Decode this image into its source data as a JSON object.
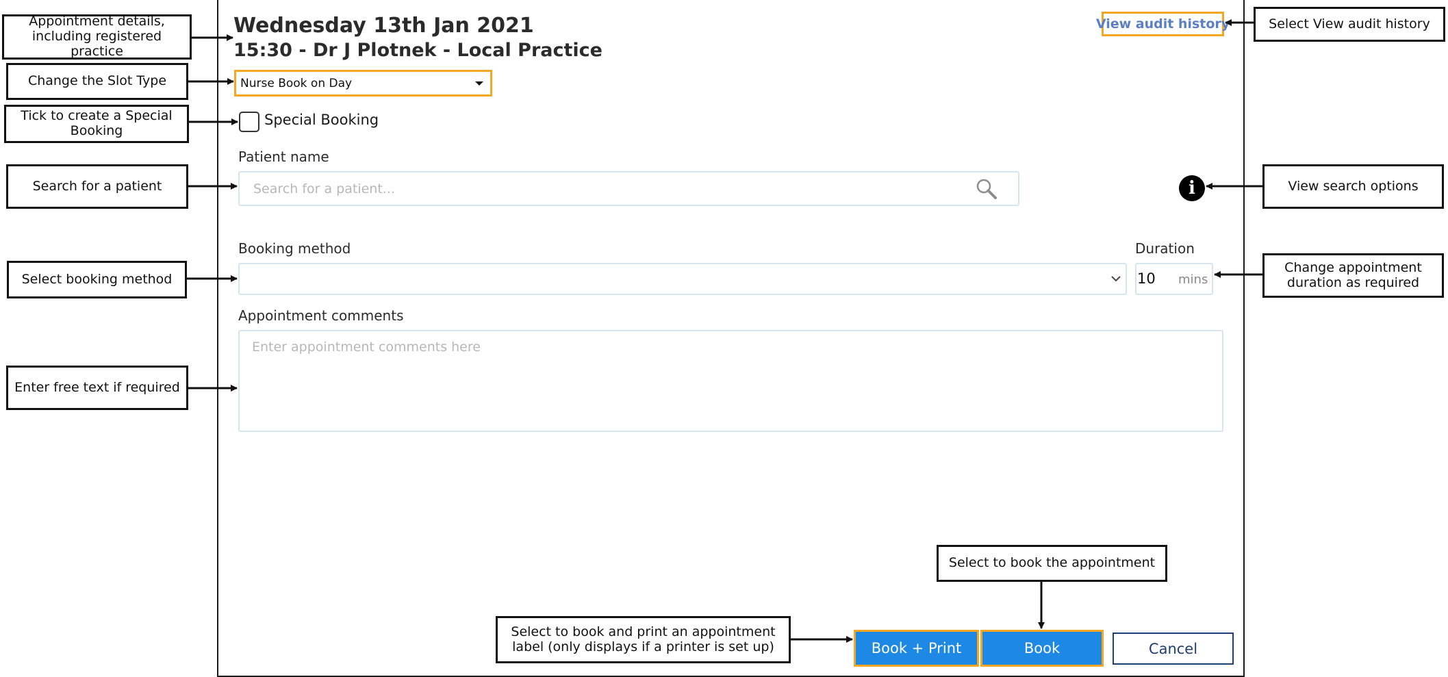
{
  "dialog": {
    "date_heading": "Wednesday 13th Jan 2021",
    "slot_heading": "15:30 - Dr J Plotnek - Local Practice",
    "audit_link": "View audit history",
    "slot_type_value": "Nurse Book on Day",
    "special_booking_label": "Special Booking",
    "special_booking_checked": false,
    "patient": {
      "label": "Patient name",
      "placeholder": "Search for a patient..."
    },
    "info_icon_glyph": "i",
    "booking_method": {
      "label": "Booking method",
      "value": ""
    },
    "duration": {
      "label": "Duration",
      "value": "10",
      "unit": "mins"
    },
    "comments": {
      "label": "Appointment comments",
      "placeholder": "Enter appointment comments here"
    },
    "buttons": {
      "book_print": "Book + Print",
      "book": "Book",
      "cancel": "Cancel"
    }
  },
  "callouts": {
    "appointment_details": "Appointment details, including registered practice",
    "slot_type": "Change the Slot Type",
    "special_booking": "Tick to create a Special Booking",
    "search_patient": "Search for a patient",
    "booking_method": "Select booking method",
    "free_text": "Enter free text if required",
    "audit_history": "Select View audit history",
    "search_options": "View search options",
    "duration": "Change appointment duration as required",
    "book": "Select to book the appointment",
    "book_print": "Select to book and print an appointment label (only displays if a printer is set up)"
  },
  "colors": {
    "highlight": "#f5a623",
    "primary_button": "#1e88e5",
    "link": "#5b7fc4",
    "cancel_border": "#1f3f73",
    "input_border": "#d6e6ef"
  }
}
